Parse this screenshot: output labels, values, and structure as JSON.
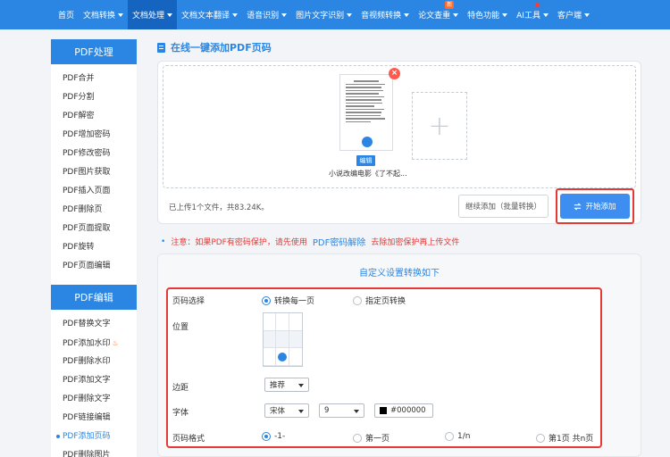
{
  "nav": {
    "items": [
      {
        "label": "首页",
        "caret": false,
        "active": false
      },
      {
        "label": "文档转换",
        "caret": true,
        "active": false
      },
      {
        "label": "文档处理",
        "caret": true,
        "active": true
      },
      {
        "label": "文档文本翻译",
        "caret": true,
        "active": false
      },
      {
        "label": "语音识别",
        "caret": true,
        "active": false
      },
      {
        "label": "图片文字识别",
        "caret": true,
        "active": false
      },
      {
        "label": "音视频转换",
        "caret": true,
        "active": false
      },
      {
        "label": "论文查重",
        "caret": true,
        "active": false,
        "badge": "新"
      },
      {
        "label": "特色功能",
        "caret": true,
        "active": false
      },
      {
        "label": "AI工具",
        "caret": true,
        "active": false,
        "fire": true
      },
      {
        "label": "客户端",
        "caret": true,
        "active": false
      }
    ]
  },
  "sidebar": {
    "sections": [
      {
        "title": "PDF处理",
        "items": [
          "PDF合并",
          "PDF分割",
          "PDF解密",
          "PDF增加密码",
          "PDF修改密码",
          "PDF图片获取",
          "PDF插入页面",
          "PDF删除页",
          "PDF页面提取",
          "PDF旋转",
          "PDF页面编辑"
        ]
      },
      {
        "title": "PDF编辑",
        "items": [
          "PDF替换文字",
          "PDF添加水印",
          "PDF删除水印",
          "PDF添加文字",
          "PDF删除文字",
          "PDF链接编辑",
          "PDF添加页码",
          "PDF删除图片"
        ],
        "flame_item": "PDF添加水印",
        "active_item": "PDF添加页码"
      }
    ]
  },
  "page": {
    "title": "在线一键添加PDF页码",
    "file": {
      "edit_label": "编辑",
      "name": "小说改编电影《了不起..."
    },
    "upload_status": "已上传1个文件，共83.24K。",
    "continue_button": "继续添加（批量转换）",
    "start_button": "开始添加",
    "notice": {
      "prefix": "注意：如果PDF有密码保护，请先使用",
      "link": "PDF密码解除",
      "suffix": "去除加密保护再上传文件"
    }
  },
  "settings": {
    "title": "自定义设置转换如下",
    "page_select": {
      "label": "页码选择",
      "options": [
        "转换每一页",
        "指定页转换"
      ],
      "selected": 0
    },
    "position": {
      "label": "位置",
      "selected_cell": "bottom-center"
    },
    "margin": {
      "label": "边距",
      "value": "推荐"
    },
    "font": {
      "label": "字体",
      "family": "宋体",
      "size": "9",
      "color": "#000000"
    },
    "format": {
      "label": "页码格式",
      "options": [
        "-1-",
        "第一页",
        "1/n",
        "第1页 共n页"
      ],
      "selected": 0
    }
  },
  "colors": {
    "brand": "#2b86e3",
    "highlight": "#e53935"
  }
}
